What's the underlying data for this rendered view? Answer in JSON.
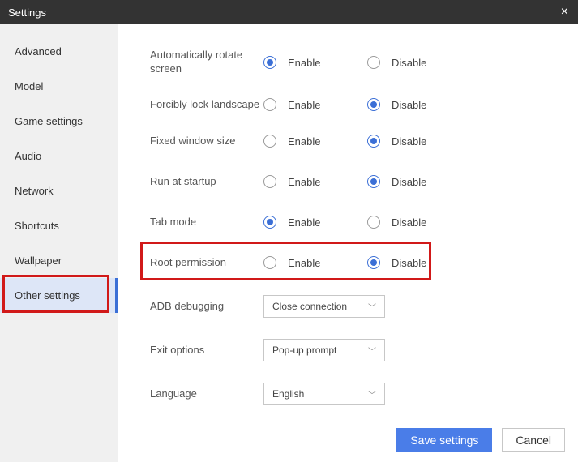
{
  "window": {
    "title": "Settings",
    "close_icon": "×"
  },
  "sidebar": {
    "items": [
      {
        "label": "Advanced"
      },
      {
        "label": "Model"
      },
      {
        "label": "Game settings"
      },
      {
        "label": "Audio"
      },
      {
        "label": "Network"
      },
      {
        "label": "Shortcuts"
      },
      {
        "label": "Wallpaper"
      },
      {
        "label": "Other settings"
      }
    ],
    "active_index": 7,
    "highlighted_index": 7
  },
  "options": {
    "enable_label": "Enable",
    "disable_label": "Disable",
    "rows": [
      {
        "key": "auto_rotate",
        "label": "Automatically rotate screen",
        "value": "enable"
      },
      {
        "key": "forcibly_lock",
        "label": "Forcibly lock landscape",
        "value": "disable"
      },
      {
        "key": "fixed_window",
        "label": "Fixed window size",
        "value": "disable"
      },
      {
        "key": "run_startup",
        "label": "Run at startup",
        "value": "disable"
      },
      {
        "key": "tab_mode",
        "label": "Tab mode",
        "value": "enable"
      },
      {
        "key": "root_permission",
        "label": "Root permission",
        "value": "disable",
        "highlighted": true
      }
    ]
  },
  "dropdowns": {
    "adb": {
      "label": "ADB debugging",
      "value": "Close connection"
    },
    "exit": {
      "label": "Exit options",
      "value": "Pop-up prompt"
    },
    "language": {
      "label": "Language",
      "value": "English"
    }
  },
  "footer": {
    "save": "Save settings",
    "cancel": "Cancel"
  },
  "icons": {
    "chevron_down": "﹀"
  },
  "colors": {
    "accent": "#3b6fd6",
    "highlight_border": "#d11919",
    "titlebar_bg": "#333333",
    "sidebar_bg": "#f0f0f0"
  }
}
